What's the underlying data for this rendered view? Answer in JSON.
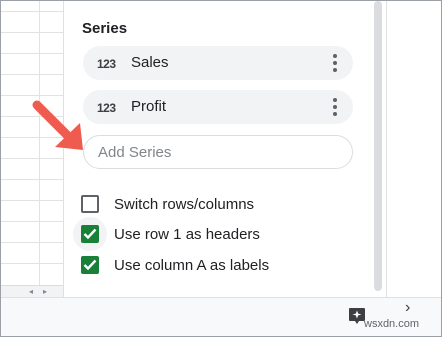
{
  "series_section": {
    "title": "Series",
    "items": [
      {
        "type_icon": "123",
        "label": "Sales"
      },
      {
        "type_icon": "123",
        "label": "Profit"
      }
    ],
    "add_series_placeholder": "Add Series"
  },
  "options": [
    {
      "label": "Switch rows/columns",
      "checked": false
    },
    {
      "label": "Use row 1 as headers",
      "checked": true
    },
    {
      "label": "Use column A as labels",
      "checked": true
    }
  ],
  "icons": {
    "more": "kebab-menu-icon",
    "explore": "explore-sparkle-icon",
    "expand": "chevron-right-icon",
    "annotation": "red-arrow-annotation"
  },
  "colors": {
    "checkbox_checked": "#188038",
    "annotation_arrow": "#ef5b4f",
    "chip_background": "#f1f3f4"
  },
  "scroll_arrows": {
    "left": "◂",
    "right": "▸"
  },
  "watermark": "wsxdn.com"
}
